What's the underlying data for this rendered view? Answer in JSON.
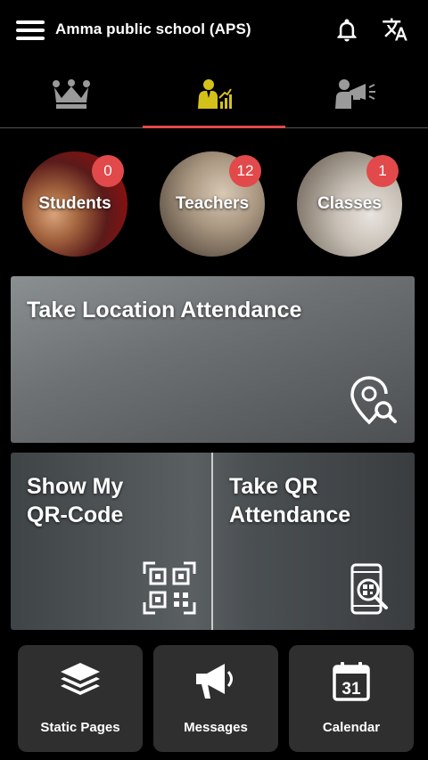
{
  "header": {
    "title": "Amma public school (APS)",
    "icons": [
      "menu-icon",
      "bell-icon",
      "translate-icon"
    ]
  },
  "tabs": [
    {
      "name": "admin-tab",
      "icon": "crown-icon"
    },
    {
      "name": "teacher-performance-tab",
      "icon": "person-chart-icon",
      "active": true
    },
    {
      "name": "announcements-tab",
      "icon": "speaker-megaphone-icon"
    }
  ],
  "circles": [
    {
      "label": "Students",
      "count": "0"
    },
    {
      "label": "Teachers",
      "count": "12"
    },
    {
      "label": "Classes",
      "count": "1"
    }
  ],
  "cards": {
    "location": {
      "title": "Take Location Attendance",
      "icon": "location-search-icon"
    },
    "show_qr": {
      "title_line1": "Show My",
      "title_line2": "QR-Code",
      "icon": "qr-code-icon"
    },
    "take_qr": {
      "title_line1": "Take QR",
      "title_line2": "Attendance",
      "icon": "phone-qr-scan-icon"
    }
  },
  "tiles": [
    {
      "label": "Static Pages",
      "icon": "layers-icon"
    },
    {
      "label": "Messages",
      "icon": "megaphone-icon"
    },
    {
      "label": "Calendar",
      "icon": "calendar-icon",
      "day": "31"
    }
  ],
  "colors": {
    "accent": "#e2494a",
    "active_tab_icon": "#d4c21a",
    "background": "#000000",
    "tile": "#2f2f2f"
  }
}
